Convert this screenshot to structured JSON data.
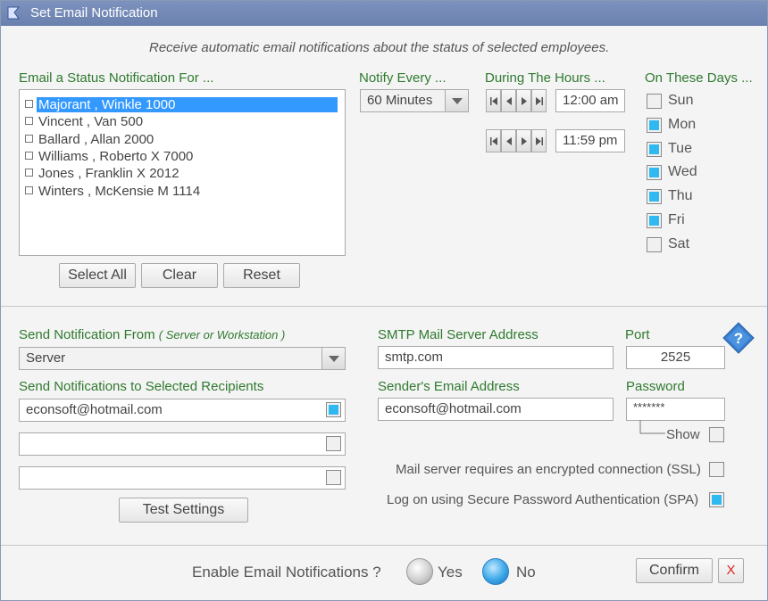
{
  "window": {
    "title": "Set Email Notification"
  },
  "header": {
    "subtitle": "Receive automatic email notifications about the status of selected employees."
  },
  "employees": {
    "label": "Email a Status Notification For ...",
    "items": [
      {
        "name": "Majorant , Winkle  1000",
        "selected": true
      },
      {
        "name": "Vincent , Van  500",
        "selected": false
      },
      {
        "name": "Ballard , Allan  2000",
        "selected": false
      },
      {
        "name": "Williams , Roberto X 7000",
        "selected": false
      },
      {
        "name": "Jones , Franklin X  2012",
        "selected": false
      },
      {
        "name": "Winters , McKensie M 1114",
        "selected": false
      }
    ],
    "buttons": {
      "select_all": "Select All",
      "clear": "Clear",
      "reset": "Reset"
    }
  },
  "notify": {
    "label": "Notify Every ...",
    "value": "60 Minutes"
  },
  "hours": {
    "label": "During The Hours ...",
    "start": "12:00 am",
    "end": "11:59 pm"
  },
  "days": {
    "label": "On These Days ...",
    "items": [
      {
        "name": "Sun",
        "checked": false
      },
      {
        "name": "Mon",
        "checked": true
      },
      {
        "name": "Tue",
        "checked": true
      },
      {
        "name": "Wed",
        "checked": true
      },
      {
        "name": "Thu",
        "checked": true
      },
      {
        "name": "Fri",
        "checked": true
      },
      {
        "name": "Sat",
        "checked": false
      }
    ]
  },
  "send_from": {
    "label": "Send Notification From",
    "hint": "( Server or Workstation )",
    "value": "Server"
  },
  "recipients": {
    "label": "Send Notifications to Selected Recipients",
    "items": [
      {
        "value": "econsoft@hotmail.com",
        "checked": true
      },
      {
        "value": "",
        "checked": false
      },
      {
        "value": "",
        "checked": false
      }
    ],
    "test_button": "Test Settings"
  },
  "smtp": {
    "server_label": "SMTP Mail Server Address",
    "server_value": "smtp.com",
    "port_label": "Port",
    "port_value": "2525",
    "sender_label": "Sender's Email Address",
    "sender_value": "econsoft@hotmail.com",
    "password_label": "Password",
    "password_value": "*******",
    "show_label": "Show",
    "show_checked": false,
    "ssl_label": "Mail server requires an encrypted connection (SSL)",
    "ssl_checked": false,
    "spa_label": "Log on using Secure Password Authentication (SPA)",
    "spa_checked": true
  },
  "footer": {
    "enable_label": "Enable Email Notifications ?",
    "yes_label": "Yes",
    "no_label": "No",
    "selected": "No",
    "confirm_label": "Confirm",
    "close_label": "X"
  },
  "colors": {
    "accent": "#30b8f0",
    "selection": "#3399ff",
    "label_green": "#2f7a2f",
    "title_bar": "#7288b6"
  }
}
